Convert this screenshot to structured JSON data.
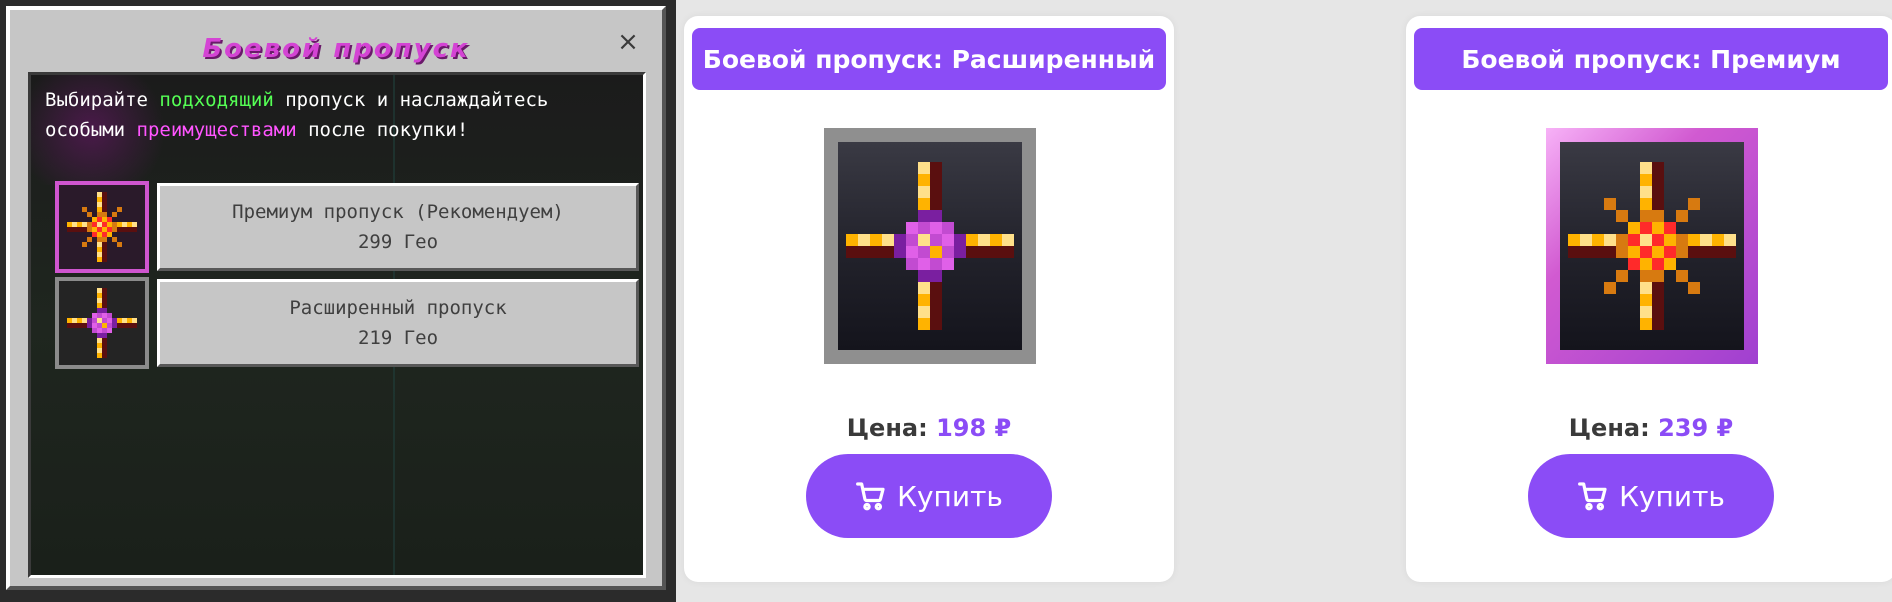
{
  "game": {
    "title": "Боевой пропуск",
    "close_label": "×",
    "intro": {
      "part1": "Выбирайте ",
      "highlight1": "подходящий",
      "part2": " пропуск и наслаждайтесь",
      "part3": "особыми ",
      "highlight2": "преимуществами",
      "part4": " после покупки!"
    },
    "passes": [
      {
        "name": "Премиум пропуск (Рекомендуем)",
        "price": "299 Гео",
        "icon": "premium-star-icon"
      },
      {
        "name": "Расширенный пропуск",
        "price": "219 Гео",
        "icon": "extended-star-icon"
      }
    ]
  },
  "cards": [
    {
      "title": "Боевой пропуск: Расширенный",
      "price_label": "Цена:",
      "price_value": "198 ₽",
      "buy_label": "Купить",
      "icon": "extended-star-icon"
    },
    {
      "title": "Боевой пропуск: Премиум",
      "price_label": "Цена:",
      "price_value": "239 ₽",
      "buy_label": "Купить",
      "icon": "premium-star-icon"
    }
  ],
  "colors": {
    "accent": "#8b4cf6",
    "game_title": "#d444d4",
    "highlight_green": "#55ff55",
    "highlight_pink": "#ff55ff"
  }
}
